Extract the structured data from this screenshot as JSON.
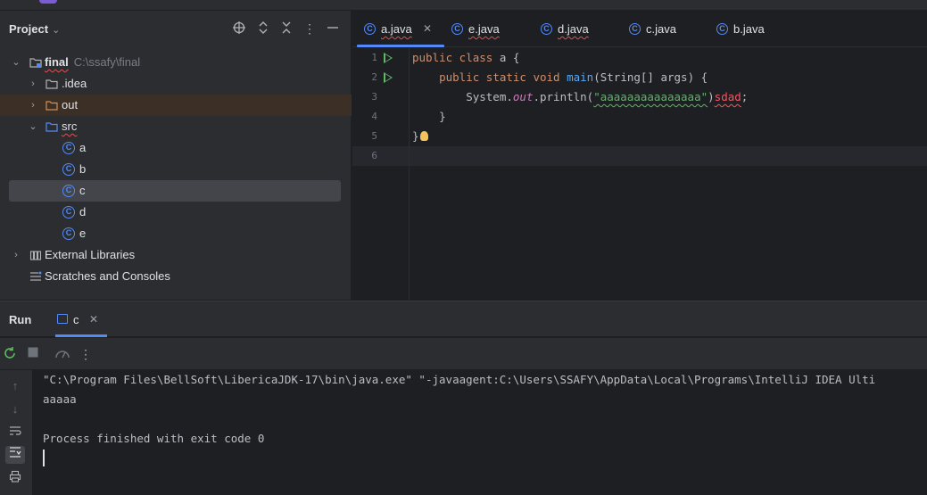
{
  "project_panel": {
    "title": "Project",
    "tree": [
      {
        "label": "final",
        "hint": "C:\\ssafy\\final",
        "kind": "module",
        "expanded": true
      },
      {
        "label": ".idea",
        "kind": "folder",
        "expanded": false
      },
      {
        "label": "out",
        "kind": "folder-excluded",
        "expanded": false
      },
      {
        "label": "src",
        "kind": "folder",
        "expanded": true
      },
      {
        "label": "a",
        "kind": "class"
      },
      {
        "label": "b",
        "kind": "class"
      },
      {
        "label": "c",
        "kind": "class",
        "selected": true
      },
      {
        "label": "d",
        "kind": "class"
      },
      {
        "label": "e",
        "kind": "class"
      },
      {
        "label": "External Libraries",
        "kind": "library",
        "expanded": false
      },
      {
        "label": "Scratches and Consoles",
        "kind": "scratches"
      }
    ],
    "icons": [
      "locate-icon",
      "expand-collapse-icon",
      "collapse-all-icon",
      "more-icon",
      "hide-icon"
    ]
  },
  "editor": {
    "tabs": [
      {
        "label": "a.java",
        "active": true
      },
      {
        "label": "e.java"
      },
      {
        "label": "d.java"
      },
      {
        "label": "c.java"
      },
      {
        "label": "b.java"
      }
    ],
    "line_numbers": [
      "1",
      "2",
      "3",
      "4",
      "5",
      "6"
    ],
    "code": {
      "l1_kw": "public class",
      "l1_rest": " a {",
      "l2_indent": "    ",
      "l2_kw": "public static void",
      "l2_sp": " ",
      "l2_fn": "main",
      "l2_rest": "(String[] args) {",
      "l3_pre": "        System.",
      "l3_field": "out",
      "l3_mid": ".println(",
      "l3_str": "\"aaaaaaaaaaaaaaa\"",
      "l3_close": ")",
      "l3_err": "sdad",
      "l3_end": ";",
      "l4": "    }",
      "l5": "}"
    }
  },
  "run_panel": {
    "title": "Run",
    "tab_label": "c",
    "console": [
      "\"C:\\Program Files\\BellSoft\\LibericaJDK-17\\bin\\java.exe\" \"-javaagent:C:\\Users\\SSAFY\\AppData\\Local\\Programs\\IntelliJ IDEA Ulti",
      "aaaaa",
      "",
      "Process finished with exit code 0"
    ]
  },
  "colors": {
    "accent": "#548af7",
    "keyword": "#cf8e6d",
    "string": "#6aab73",
    "error": "#f75464",
    "run_green": "#5fb865"
  }
}
